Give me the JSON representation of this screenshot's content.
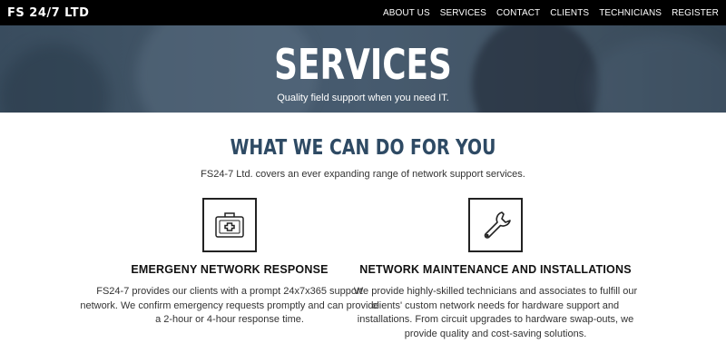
{
  "navbar": {
    "brand": "FS  24/7 LTD",
    "links": [
      "ABOUT US",
      "SERVICES",
      "CONTACT",
      "CLIENTS",
      "TECHNICIANS",
      "REGISTER"
    ]
  },
  "hero": {
    "title": "SERVICES",
    "subtitle": "Quality field support when you need IT."
  },
  "main": {
    "title": "WHAT WE CAN DO FOR YOU",
    "intro": "FS24-7 Ltd. covers an ever expanding range of network support services.",
    "services": [
      {
        "icon": "first-aid-kit-icon",
        "title": "EMERGENY NETWORK RESPONSE",
        "description": "FS24-7 provides our clients with a prompt 24x7x365 support network. We confirm emergency requests promptly and can provide a 2-hour or 4-hour response time."
      },
      {
        "icon": "wrench-icon",
        "title": "NETWORK MAINTENANCE AND INSTALLATIONS",
        "description": "We provide highly-skilled technicians and associates to fulfill our clients' custom network needs for hardware support and installations. From circuit upgrades to hardware swap-outs, we provide quality and cost-saving solutions."
      }
    ]
  },
  "colors": {
    "navbar_bg": "#000000",
    "heading": "#2e4a64",
    "text": "#333333"
  }
}
